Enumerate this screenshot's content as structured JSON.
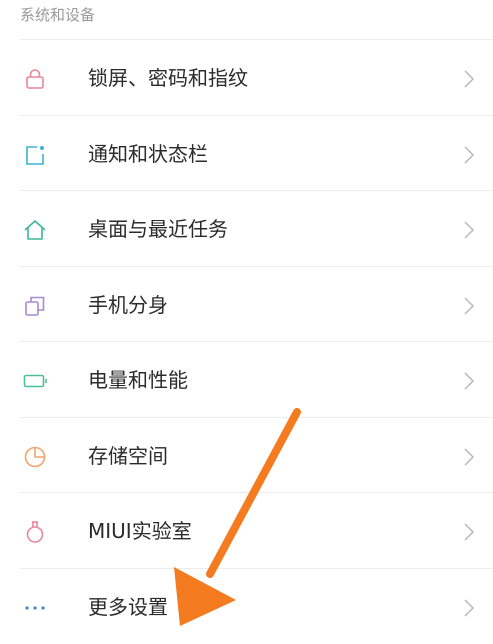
{
  "section": {
    "title": "系统和设备"
  },
  "items": [
    {
      "label": "锁屏、密码和指纹",
      "icon": "lock-icon",
      "color": "#e8879a"
    },
    {
      "label": "通知和状态栏",
      "icon": "notification-icon",
      "color": "#3bb3d6"
    },
    {
      "label": "桌面与最近任务",
      "icon": "home-icon",
      "color": "#3fb69a"
    },
    {
      "label": "手机分身",
      "icon": "dual-apps-icon",
      "color": "#a58ad6"
    },
    {
      "label": "电量和性能",
      "icon": "battery-icon",
      "color": "#4dbf9a"
    },
    {
      "label": "存储空间",
      "icon": "storage-icon",
      "color": "#f1a36b"
    },
    {
      "label": "MIUI实验室",
      "icon": "lab-flask-icon",
      "color": "#e887a0"
    },
    {
      "label": "更多设置",
      "icon": "more-dots-icon",
      "color": "#3b8ad6"
    }
  ],
  "colors": {
    "arrow": "#f47b20",
    "chevron": "#b8b8b8",
    "divider": "#ececec"
  }
}
